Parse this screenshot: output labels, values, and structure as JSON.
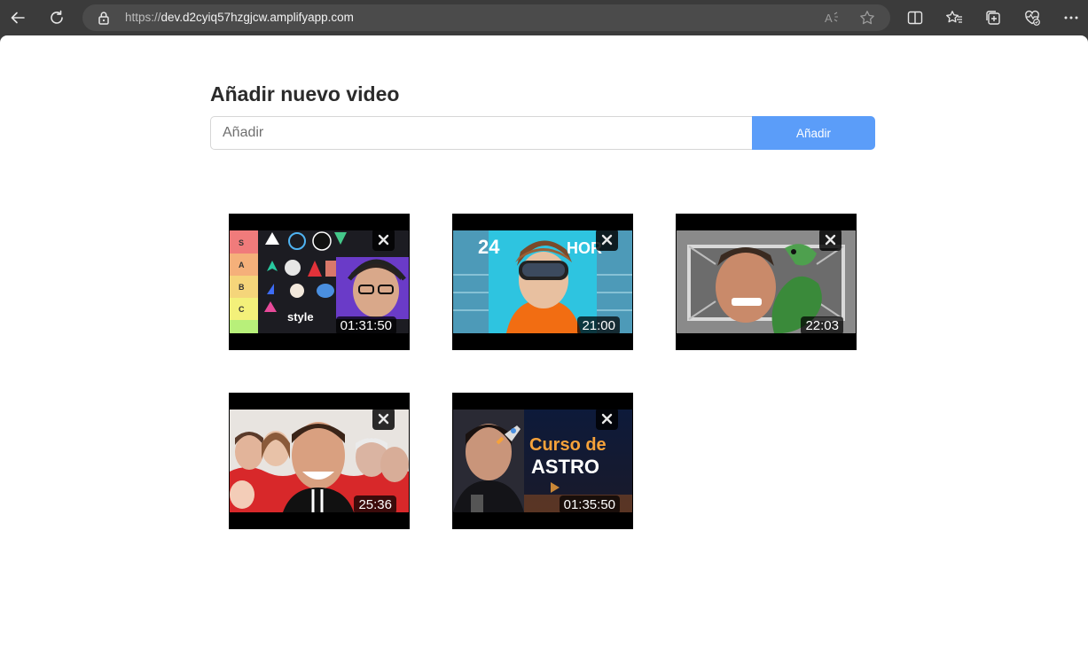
{
  "browser": {
    "url_scheme": "https://",
    "url_host": "dev.d2cyiq57hzgjcw.amplifyapp.com",
    "icons": [
      "back-icon",
      "refresh-icon",
      "lock-icon",
      "read-aloud-icon",
      "favorite-star-icon",
      "split-screen-icon",
      "favorites-icon",
      "collections-icon",
      "browser-essentials-icon",
      "more-icon"
    ]
  },
  "form": {
    "heading": "Añadir nuevo video",
    "input_placeholder": "Añadir",
    "input_value": "",
    "button_label": "Añadir"
  },
  "colors": {
    "button": "#5b9df9",
    "page_background": "#ffffff",
    "chrome_background": "#3b3b3b"
  },
  "videos": [
    {
      "duration": "01:31:50",
      "thumbnail_text": [
        "S",
        "A",
        "B",
        "C",
        "style"
      ]
    },
    {
      "duration": "21:00",
      "thumbnail_text": [
        "24",
        "HOR"
      ]
    },
    {
      "duration": "22:03",
      "thumbnail_text": []
    },
    {
      "duration": "25:36",
      "thumbnail_text": []
    },
    {
      "duration": "01:35:50",
      "thumbnail_text": [
        "Curso de",
        "ASTRO"
      ]
    }
  ]
}
